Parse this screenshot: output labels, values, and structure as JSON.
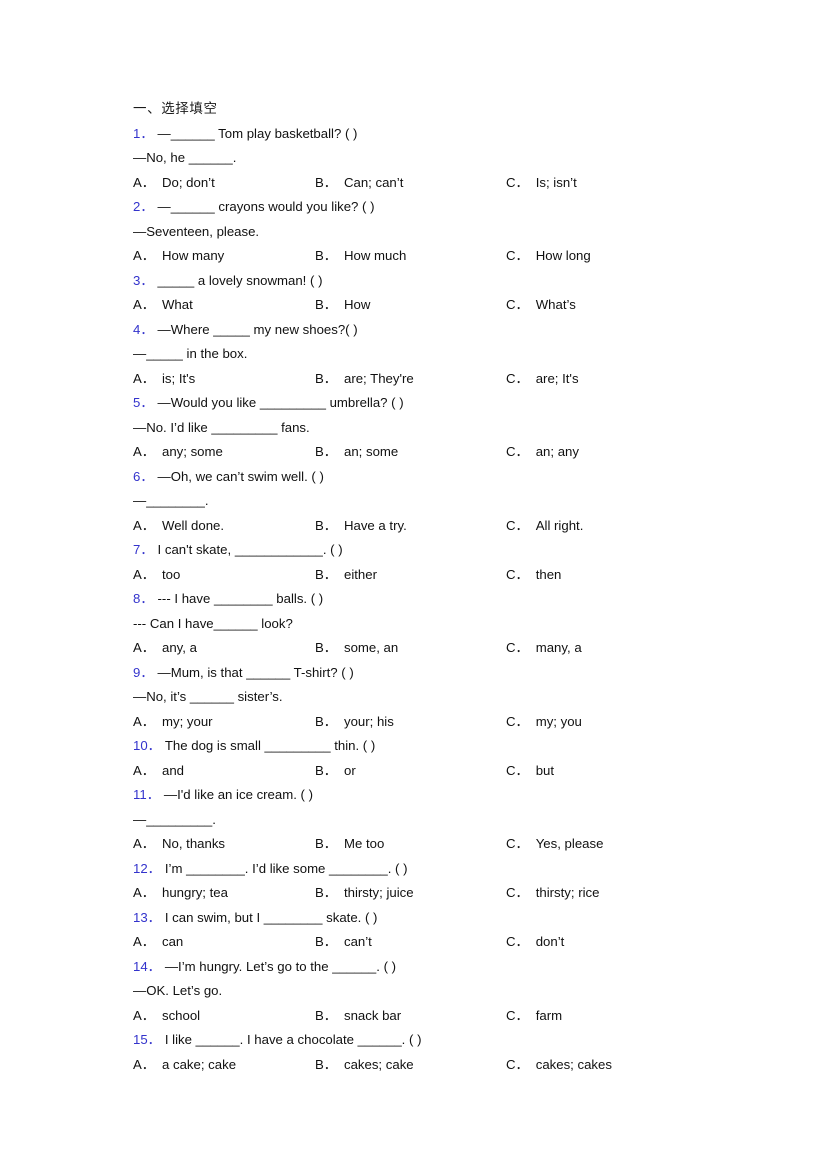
{
  "document": {
    "heading": "一、选择填空",
    "option_labels": {
      "a": "A．",
      "b": "B．",
      "c": "C．"
    },
    "number_color": "#3333cc",
    "text_color": "#111111",
    "questions": [
      {
        "number": "1．",
        "lines": [
          "—______ Tom play basketball? (    )",
          "—No, he ______."
        ],
        "options": [
          "Do; don’t",
          "Can; can’t",
          "Is; isn’t"
        ]
      },
      {
        "number": "2．",
        "lines": [
          "—______ crayons would you like? (    )",
          "—Seventeen, please."
        ],
        "options": [
          "How many",
          "How much",
          "How long"
        ]
      },
      {
        "number": "3．",
        "lines": [
          "_____ a lovely snowman! (   )"
        ],
        "options": [
          "What",
          "How",
          "What’s"
        ]
      },
      {
        "number": "4．",
        "lines": [
          "—Where _____ my new shoes?(   )",
          "—_____ in the box."
        ],
        "options": [
          "is; It's",
          "are; They're",
          "are; It's"
        ]
      },
      {
        "number": "5．",
        "lines": [
          "—Would you like _________ umbrella? (  )",
          "—No. I’d like _________ fans."
        ],
        "options": [
          "any; some",
          "an; some",
          "an; any"
        ]
      },
      {
        "number": "6．",
        "lines": [
          "—Oh, we can’t swim well. (    )",
          "—________."
        ],
        "options": [
          "Well done.",
          "Have a try.",
          "All right."
        ]
      },
      {
        "number": "7．",
        "lines": [
          "I can't skate, ____________. (  )"
        ],
        "options": [
          "too",
          "either",
          "then"
        ]
      },
      {
        "number": "8．",
        "lines": [
          "--- I have ________ balls. (   )",
          "--- Can I have______ look?"
        ],
        "options": [
          "any, a",
          "some, an",
          "many, a"
        ]
      },
      {
        "number": "9．",
        "lines": [
          "—Mum, is that ______ T-shirt? (   )",
          "—No, it’s ______ sister’s."
        ],
        "options": [
          "my; your",
          "your; his",
          "my; you"
        ]
      },
      {
        "number": "10．",
        "lines": [
          "The dog is small _________ thin. (   )"
        ],
        "options": [
          "and",
          "or",
          "but"
        ]
      },
      {
        "number": "11．",
        "lines": [
          "—I'd like an ice cream. (   )",
          "—_________."
        ],
        "options": [
          "No, thanks",
          "Me too",
          "Yes, please"
        ]
      },
      {
        "number": "12．",
        "lines": [
          "I’m ________. I’d like some ________. (   )"
        ],
        "options": [
          "hungry; tea",
          "thirsty; juice",
          "thirsty; rice"
        ]
      },
      {
        "number": "13．",
        "lines": [
          "I can swim, but I ________ skate. (   )"
        ],
        "options": [
          "can",
          "can’t",
          "don’t"
        ]
      },
      {
        "number": "14．",
        "lines": [
          "—I’m hungry. Let’s go to the ______. (   )",
          "—OK. Let’s go."
        ],
        "options": [
          "school",
          "snack bar",
          "farm"
        ]
      },
      {
        "number": "15．",
        "lines": [
          "I like ______. I have a chocolate ______. (   )"
        ],
        "options": [
          "a cake; cake",
          "cakes; cake",
          "cakes; cakes"
        ]
      }
    ]
  }
}
